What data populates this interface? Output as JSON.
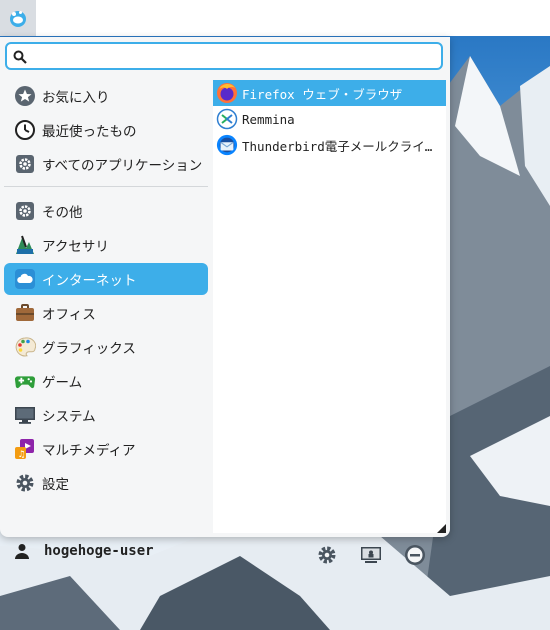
{
  "search": {
    "placeholder": "",
    "value": ""
  },
  "categories": [
    {
      "label": "お気に入り",
      "icon": "star-icon"
    },
    {
      "label": "最近使ったもの",
      "icon": "clock-icon"
    },
    {
      "label": "すべてのアプリケーション",
      "icon": "gear-icon"
    },
    {
      "label": "その他",
      "icon": "gear-icon"
    },
    {
      "label": "アクセサリ",
      "icon": "accessories-icon"
    },
    {
      "label": "インターネット",
      "icon": "cloud-icon"
    },
    {
      "label": "オフィス",
      "icon": "briefcase-icon"
    },
    {
      "label": "グラフィックス",
      "icon": "palette-icon"
    },
    {
      "label": "ゲーム",
      "icon": "gamepad-icon"
    },
    {
      "label": "システム",
      "icon": "monitor-icon"
    },
    {
      "label": "マルチメディア",
      "icon": "multimedia-icon"
    },
    {
      "label": "設定",
      "icon": "settings-icon"
    }
  ],
  "selected_category": "インターネット",
  "apps": [
    {
      "label": "Firefox ウェブ・ブラウザ",
      "icon": "firefox-icon"
    },
    {
      "label": "Remmina",
      "icon": "remmina-icon"
    },
    {
      "label": "Thunderbird電子メールクライ…",
      "icon": "thunderbird-icon"
    }
  ],
  "user": {
    "name": "hogehoge-user"
  },
  "colors": {
    "accent": "#3daee9",
    "menu_bg": "#f5f6f7"
  }
}
